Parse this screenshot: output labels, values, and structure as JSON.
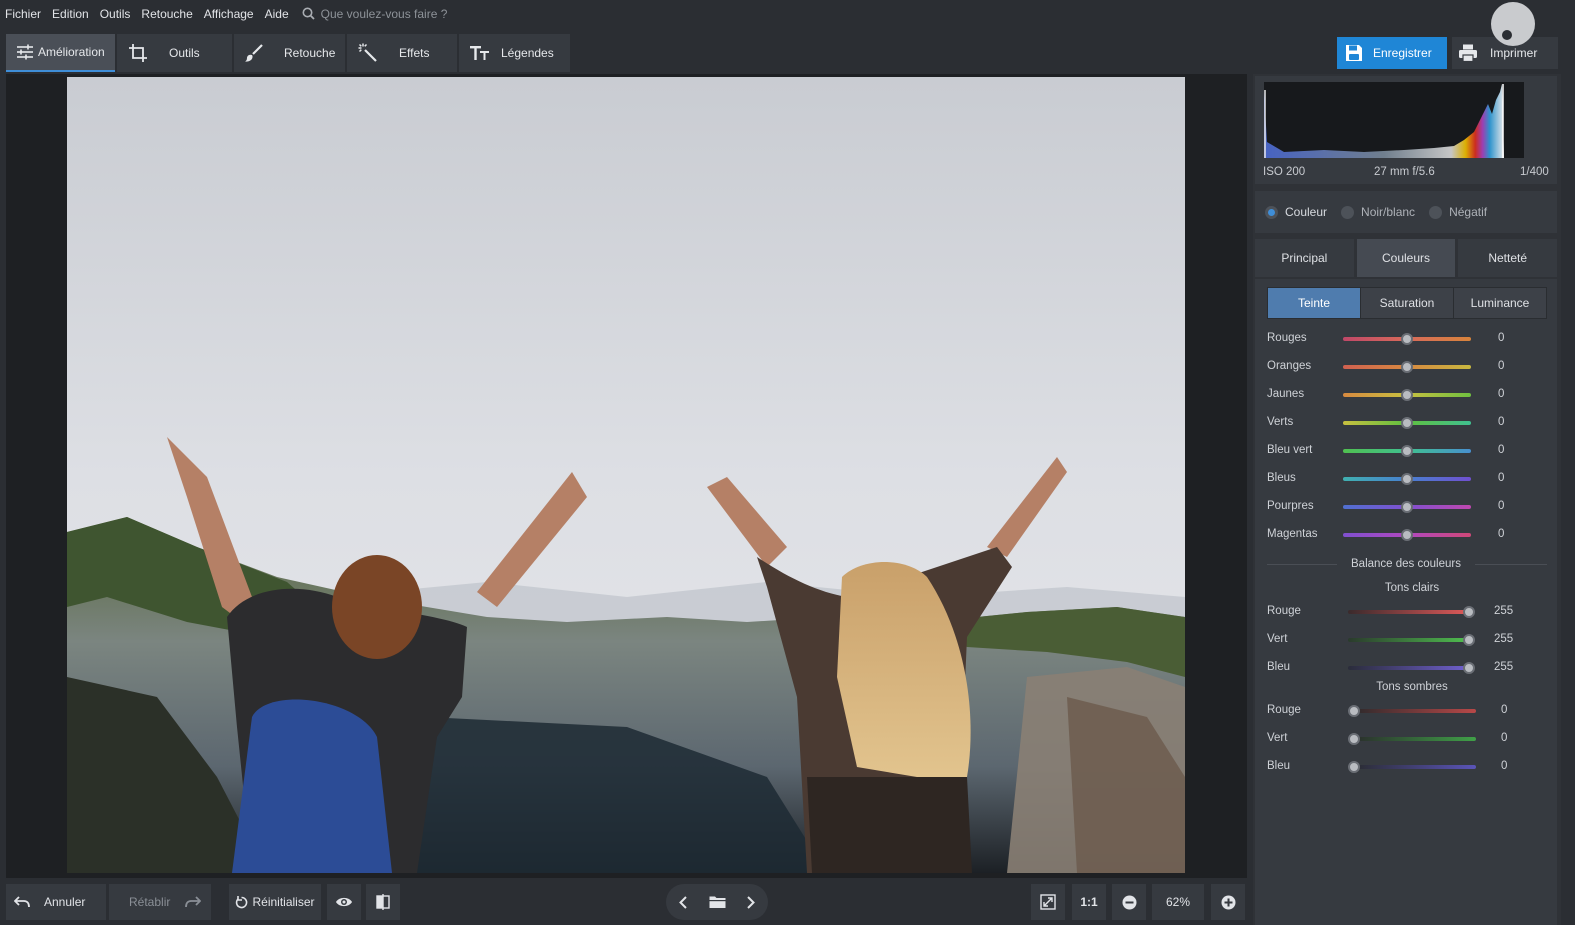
{
  "menu": {
    "items": [
      "Fichier",
      "Edition",
      "Outils",
      "Retouche",
      "Affichage",
      "Aide"
    ],
    "search_placeholder": "Que voulez-vous faire ?"
  },
  "toolbar": {
    "tabs": [
      {
        "label": "Amélioration",
        "icon": "sliders-icon"
      },
      {
        "label": "Outils",
        "icon": "crop-icon"
      },
      {
        "label": "Retouche",
        "icon": "brush-icon"
      },
      {
        "label": "Effets",
        "icon": "magic-wand-icon"
      },
      {
        "label": "Légendes",
        "icon": "text-icon"
      }
    ],
    "active_tab": "Amélioration",
    "save_label": "Enregistrer",
    "print_label": "Imprimer"
  },
  "histogram": {
    "iso": "ISO 200",
    "lens": "27 mm f/5.6",
    "shutter": "1/400"
  },
  "color_mode": {
    "options": [
      "Couleur",
      "Noir/blanc",
      "Négatif"
    ],
    "selected": "Couleur"
  },
  "panel_tabs": {
    "items": [
      "Principal",
      "Couleurs",
      "Netteté"
    ],
    "active": "Couleurs"
  },
  "sub_tabs": {
    "items": [
      "Teinte",
      "Saturation",
      "Luminance"
    ],
    "active": "Teinte"
  },
  "hue_sliders": [
    {
      "label": "Rouges",
      "value": "0"
    },
    {
      "label": "Oranges",
      "value": "0"
    },
    {
      "label": "Jaunes",
      "value": "0"
    },
    {
      "label": "Verts",
      "value": "0"
    },
    {
      "label": "Bleu vert",
      "value": "0"
    },
    {
      "label": "Bleus",
      "value": "0"
    },
    {
      "label": "Pourpres",
      "value": "0"
    },
    {
      "label": "Magentas",
      "value": "0"
    }
  ],
  "color_balance": {
    "title": "Balance des couleurs",
    "highlights_title": "Tons clairs",
    "highlights": [
      {
        "label": "Rouge",
        "value": "255"
      },
      {
        "label": "Vert",
        "value": "255"
      },
      {
        "label": "Bleu",
        "value": "255"
      }
    ],
    "shadows_title": "Tons sombres",
    "shadows": [
      {
        "label": "Rouge",
        "value": "0"
      },
      {
        "label": "Vert",
        "value": "0"
      },
      {
        "label": "Bleu",
        "value": "0"
      }
    ]
  },
  "bottom": {
    "undo_label": "Annuler",
    "redo_label": "Rétablir",
    "reset_label": "Réinitialiser",
    "actual_size_label": "1:1",
    "zoom_value": "62%"
  },
  "colors": {
    "accent": "#1f86d6",
    "tab_active_bg": "#4f7cae",
    "panel_bg": "#363a40",
    "app_bg": "#2b2e33"
  }
}
